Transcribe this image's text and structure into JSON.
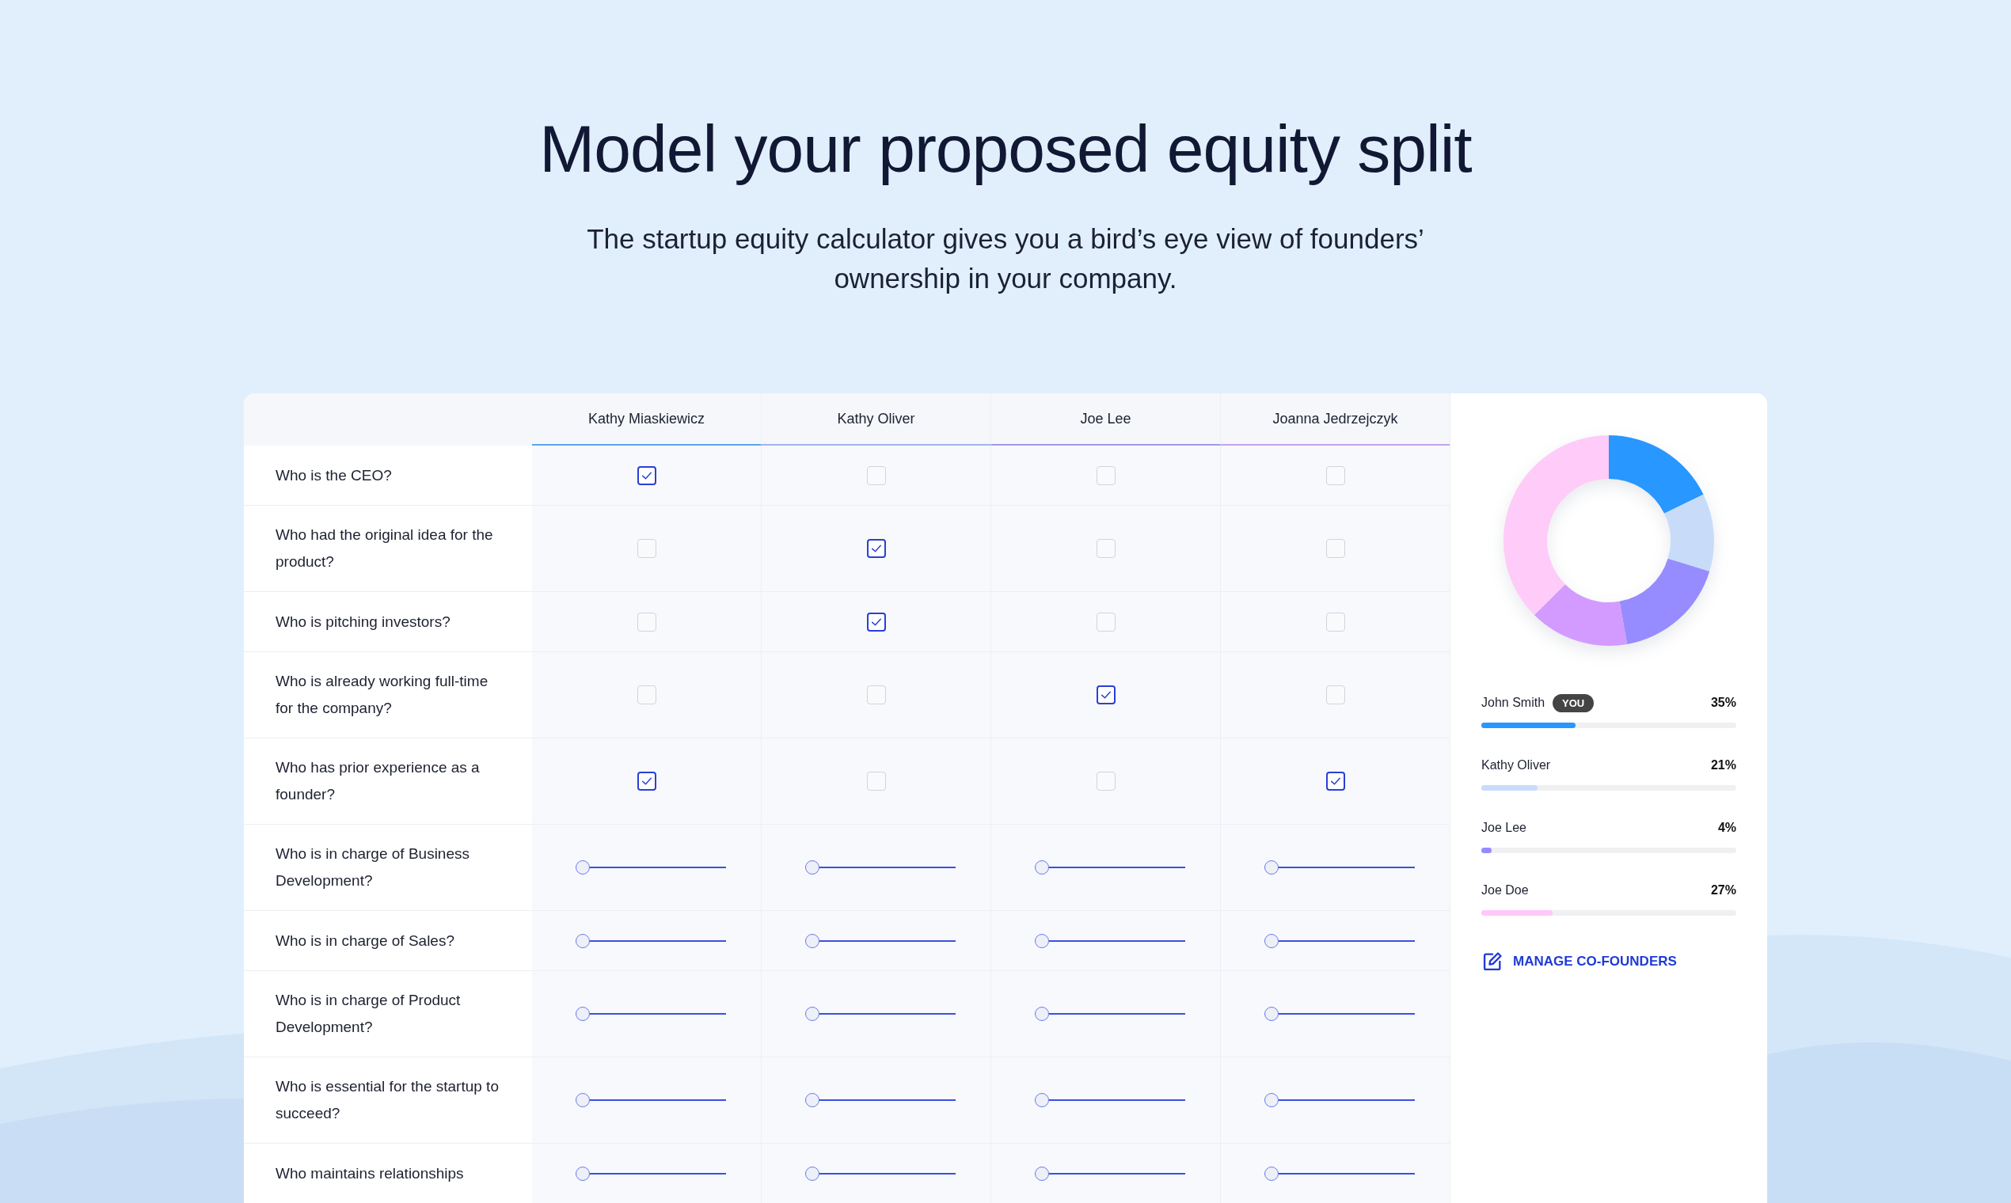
{
  "title": "Model your proposed equity split",
  "subtitle": "The startup equity calculator gives you a bird’s eye view of founders’ ownership in your company.",
  "table": {
    "columns": [
      {
        "name": "Kathy Miaskiewicz",
        "color": "#5aa6ec"
      },
      {
        "name": "Kathy Oliver",
        "color": "#a3b2ea"
      },
      {
        "name": "Joe Lee",
        "color": "#a596ea"
      },
      {
        "name": "Joanna Jedrzejczyk",
        "color": "#c4a2ec"
      }
    ],
    "rows": [
      {
        "question": "Who is the CEO?",
        "kind": "checkbox",
        "cells": [
          {
            "checked": true
          },
          {
            "checked": false
          },
          {
            "checked": false
          },
          {
            "checked": false
          }
        ]
      },
      {
        "question": "Who had the original idea for the product?",
        "kind": "checkbox",
        "cells": [
          {
            "checked": false
          },
          {
            "checked": true
          },
          {
            "checked": false
          },
          {
            "checked": false
          }
        ]
      },
      {
        "question": "Who is pitching investors?",
        "kind": "checkbox",
        "cells": [
          {
            "checked": false
          },
          {
            "checked": true
          },
          {
            "checked": false
          },
          {
            "checked": false
          }
        ]
      },
      {
        "question": "Who is already working full-time for the company?",
        "kind": "checkbox",
        "cells": [
          {
            "checked": false
          },
          {
            "checked": false
          },
          {
            "checked": true
          },
          {
            "checked": false
          }
        ]
      },
      {
        "question": "Who has prior experience as a founder?",
        "kind": "checkbox",
        "cells": [
          {
            "checked": true
          },
          {
            "checked": false
          },
          {
            "checked": false
          },
          {
            "checked": true
          }
        ]
      },
      {
        "question": "Who is in charge of Business Development?",
        "kind": "slider",
        "cells": [
          {
            "level": 0
          },
          {
            "level": 0
          },
          {
            "level": 0
          },
          {
            "level": 0
          }
        ]
      },
      {
        "question": "Who is in charge of Sales?",
        "kind": "slider",
        "cells": [
          {
            "level": 0
          },
          {
            "level": 0
          },
          {
            "level": 0
          },
          {
            "level": 0
          }
        ]
      },
      {
        "question": "Who is in charge of Product Development?",
        "kind": "slider",
        "cells": [
          {
            "level": 0
          },
          {
            "level": 0
          },
          {
            "level": 0
          },
          {
            "level": 0
          }
        ]
      },
      {
        "question": "Who is essential for the startup to succeed?",
        "kind": "slider",
        "cells": [
          {
            "level": 0
          },
          {
            "level": 0
          },
          {
            "level": 0
          },
          {
            "level": 0
          }
        ]
      },
      {
        "question": "Who maintains relationships",
        "kind": "slider",
        "cells": [
          {
            "level": 0
          },
          {
            "level": 0
          },
          {
            "level": 0
          },
          {
            "level": 0
          }
        ]
      }
    ]
  },
  "summary": {
    "founders": [
      {
        "name": "John Smith",
        "badge": "YOU",
        "share": "35%",
        "level": 0.37,
        "color": "#2897ff"
      },
      {
        "name": "Kathy Oliver",
        "share": "21%",
        "level": 0.22,
        "color": "#c8dcfa"
      },
      {
        "name": "Joe Lee",
        "share": "4%",
        "level": 0.04,
        "color": "#968cff"
      },
      {
        "name": "Joe Doe",
        "share": "27%",
        "level": 0.28,
        "color": "#ffc8f8"
      }
    ],
    "link": "MANAGE CO-FOUNDERS"
  }
}
